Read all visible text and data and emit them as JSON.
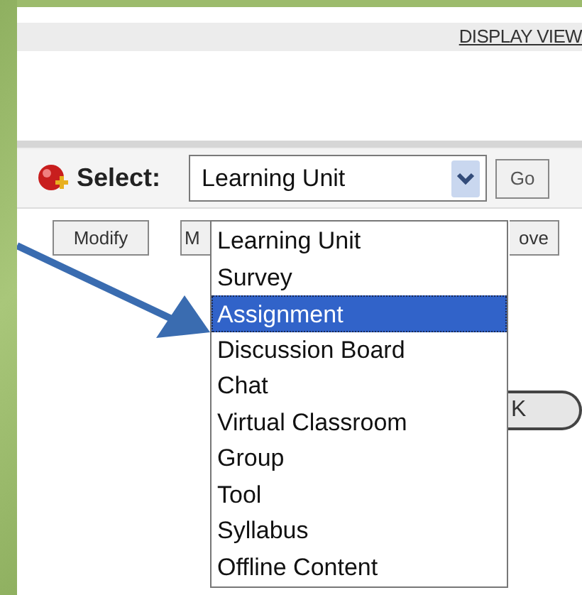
{
  "header": {
    "link": "DISPLAY VIEW"
  },
  "select": {
    "label": "Select:",
    "value": "Learning Unit",
    "go": "Go"
  },
  "buttons": [
    "Modify",
    "M",
    "ove"
  ],
  "covered_button": "K",
  "dropdown": [
    {
      "label": "Learning Unit",
      "selected": false
    },
    {
      "label": "Survey",
      "selected": false
    },
    {
      "label": "Assignment",
      "selected": true
    },
    {
      "label": "Discussion Board",
      "selected": false
    },
    {
      "label": "Chat",
      "selected": false
    },
    {
      "label": "Virtual Classroom",
      "selected": false
    },
    {
      "label": "Group",
      "selected": false
    },
    {
      "label": "Tool",
      "selected": false
    },
    {
      "label": "Syllabus",
      "selected": false
    },
    {
      "label": "Offline Content",
      "selected": false
    }
  ]
}
